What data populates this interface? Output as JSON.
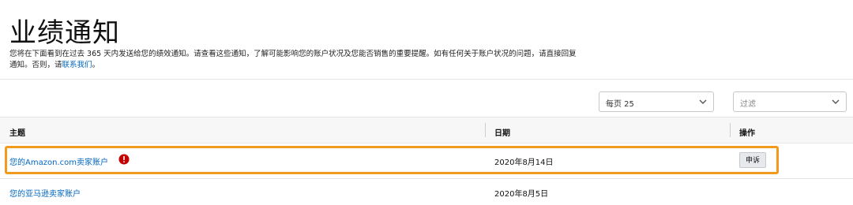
{
  "page": {
    "title": "业绩通知",
    "intro_text": "您将在下面看到在过去 365 天内发送给您的绩效通知。请查看这些通知，了解可能影响您的账户状况及您能否销售的重要提醒。如有任何关于账户状况的问题，请直接回复通知。否则，请",
    "intro_link": "联系我们",
    "intro_end": "。"
  },
  "controls": {
    "per_page": "每页 25",
    "filter_placeholder": "过滤"
  },
  "table": {
    "headers": {
      "subject": "主题",
      "date": "日期",
      "action": "操作"
    },
    "rows": [
      {
        "subject": "您的Amazon.com卖家账户",
        "date": "2020年8月14日",
        "action": "申诉",
        "alert": true
      },
      {
        "subject": "您的亚马逊卖家账户",
        "date": "2020年8月5日"
      }
    ]
  },
  "colors": {
    "highlight": "#f29a1f",
    "link": "#0066c0",
    "alert": "#c40000"
  }
}
